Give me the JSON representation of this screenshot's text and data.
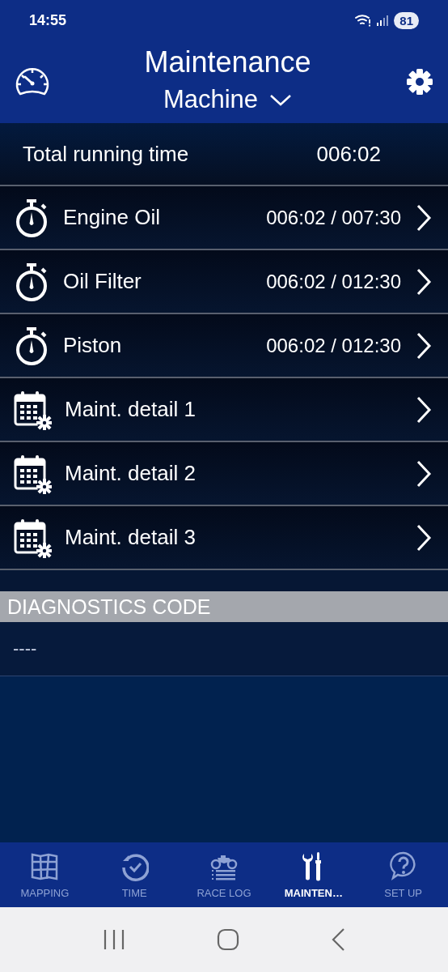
{
  "status_bar": {
    "time": "14:55",
    "battery": "81"
  },
  "header": {
    "title": "Maintenance",
    "subtitle": "Machine"
  },
  "total": {
    "label": "Total running time",
    "value": "006:02"
  },
  "items": [
    {
      "kind": "timer",
      "label": "Engine Oil",
      "value": "006:02 / 007:30"
    },
    {
      "kind": "timer",
      "label": "Oil Filter",
      "value": "006:02 / 012:30"
    },
    {
      "kind": "timer",
      "label": "Piston",
      "value": "006:02 / 012:30"
    },
    {
      "kind": "schedule",
      "label": "Maint. detail 1"
    },
    {
      "kind": "schedule",
      "label": "Maint. detail 2"
    },
    {
      "kind": "schedule",
      "label": "Maint. detail 3"
    }
  ],
  "diagnostics": {
    "title": "DIAGNOSTICS CODE",
    "code": "----"
  },
  "tabs": [
    {
      "kind": "map",
      "label": "MAPPING",
      "selected": false
    },
    {
      "kind": "time",
      "label": "TIME",
      "selected": false
    },
    {
      "kind": "racelog",
      "label": "RACE LOG",
      "selected": false
    },
    {
      "kind": "tools",
      "label": "MAINTEN…",
      "selected": true
    },
    {
      "kind": "help",
      "label": "SET UP",
      "selected": false
    }
  ]
}
